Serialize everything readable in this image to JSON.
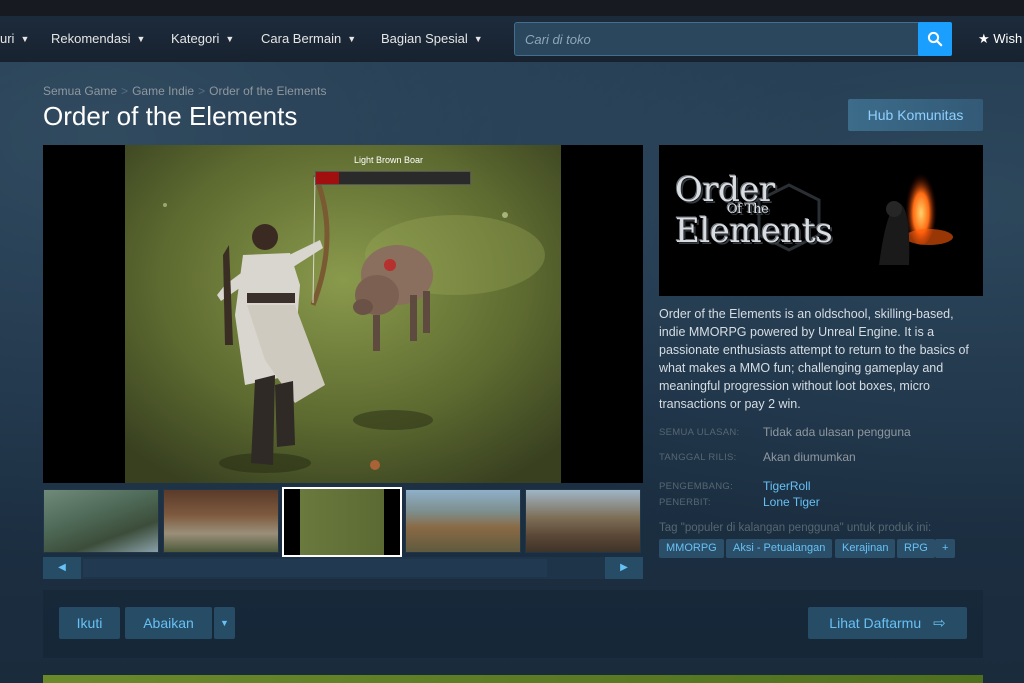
{
  "nav": {
    "items": [
      {
        "label": "uri",
        "has_dropdown": true
      },
      {
        "label": "Rekomendasi",
        "has_dropdown": true
      },
      {
        "label": "Kategori",
        "has_dropdown": true
      },
      {
        "label": "Cara Bermain",
        "has_dropdown": true
      },
      {
        "label": "Bagian Spesial",
        "has_dropdown": true
      }
    ],
    "search_placeholder": "Cari di toko",
    "wishlist_label": "Wish"
  },
  "breadcrumb": [
    "Semua Game",
    "Game Indie",
    "Order of the Elements"
  ],
  "breadcrumb_sep": ">",
  "page_title": "Order of the Elements",
  "hub_button": "Hub Komunitas",
  "screenshot": {
    "overlay_label": "Light Brown Boar",
    "health_fraction": 0.15
  },
  "capsule": {
    "logo_top": "Order",
    "logo_middle": "Of The",
    "logo_bottom": "Elements"
  },
  "description": "Order of the Elements is an oldschool, skilling-based, indie MMORPG powered by Unreal Engine. It is a passionate enthusiasts attempt to return to the basics of what makes a MMO fun; challenging gameplay and meaningful progression without loot boxes, micro transactions or pay 2 win.",
  "info": {
    "reviews_label": "SEMUA ULASAN:",
    "reviews_value": "Tidak ada ulasan pengguna",
    "release_label": "TANGGAL RILIS:",
    "release_value": "Akan diumumkan",
    "developer_label": "PENGEMBANG:",
    "developer_value": "TigerRoll",
    "publisher_label": "PENERBIT:",
    "publisher_value": "Lone Tiger"
  },
  "tags_title": "Tag \"populer di kalangan pengguna\" untuk produk ini:",
  "tags": [
    "MMORPG",
    "Aksi - Petualangan",
    "Kerajinan",
    "RPG",
    "+"
  ],
  "actions": {
    "follow": "Ikuti",
    "ignore": "Abaikan",
    "view_list": "Lihat Daftarmu"
  },
  "colors": {
    "accent": "#66c0f4",
    "search_button": "#1a9fff",
    "background": "#1b2838"
  }
}
